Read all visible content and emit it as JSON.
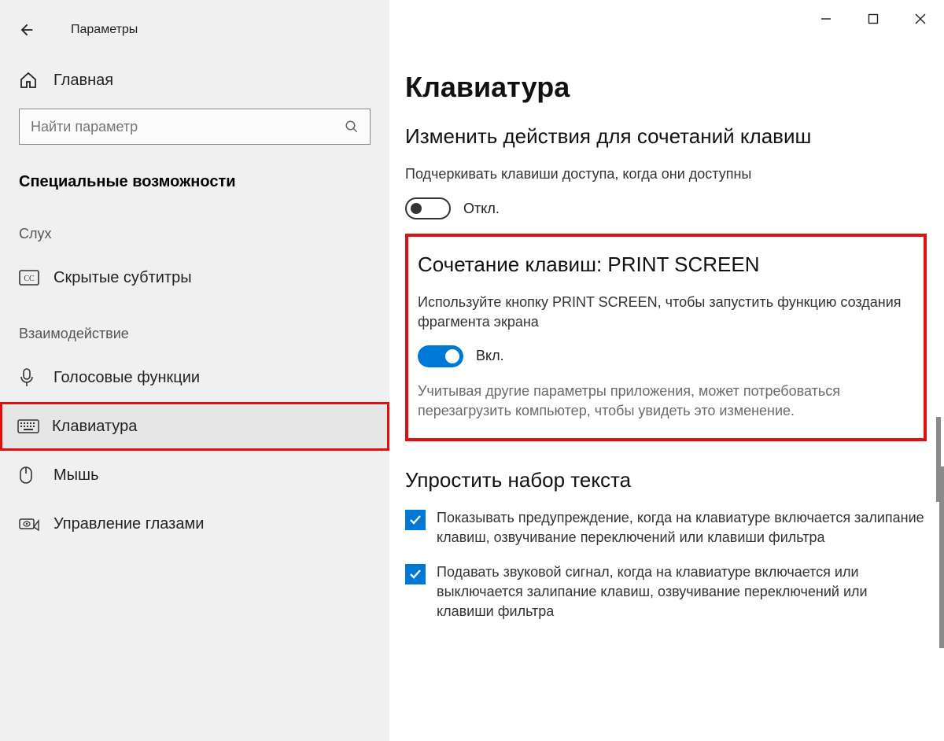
{
  "window": {
    "title": "Параметры"
  },
  "sidebar": {
    "home": "Главная",
    "search_placeholder": "Найти параметр",
    "heading": "Специальные возможности",
    "group_hearing": "Слух",
    "group_interaction": "Взаимодействие",
    "items": {
      "closed_captions": "Скрытые субтитры",
      "speech": "Голосовые функции",
      "keyboard": "Клавиатура",
      "mouse": "Мышь",
      "eye_control": "Управление глазами"
    }
  },
  "content": {
    "page_title": "Клавиатура",
    "section1": {
      "title": "Изменить действия для сочетаний клавиш",
      "desc": "Подчеркивать клавиши доступа, когда они доступны",
      "toggle_state": "Откл."
    },
    "section2": {
      "title": "Сочетание клавиш: PRINT SCREEN",
      "desc": "Используйте кнопку PRINT SCREEN, чтобы запустить функцию создания фрагмента экрана",
      "toggle_state": "Вкл.",
      "note": "Учитывая другие параметры приложения, может потребоваться перезагрузить компьютер, чтобы увидеть это изменение."
    },
    "section3": {
      "title": "Упростить набор текста",
      "check1": "Показывать предупреждение, когда на клавиатуре включается залипание клавиш, озвучивание переключений или клавиши фильтра",
      "check2": "Подавать звуковой сигнал, когда на клавиатуре включается или выключается залипание клавиш, озвучивание переключений или клавиши фильтра"
    }
  }
}
